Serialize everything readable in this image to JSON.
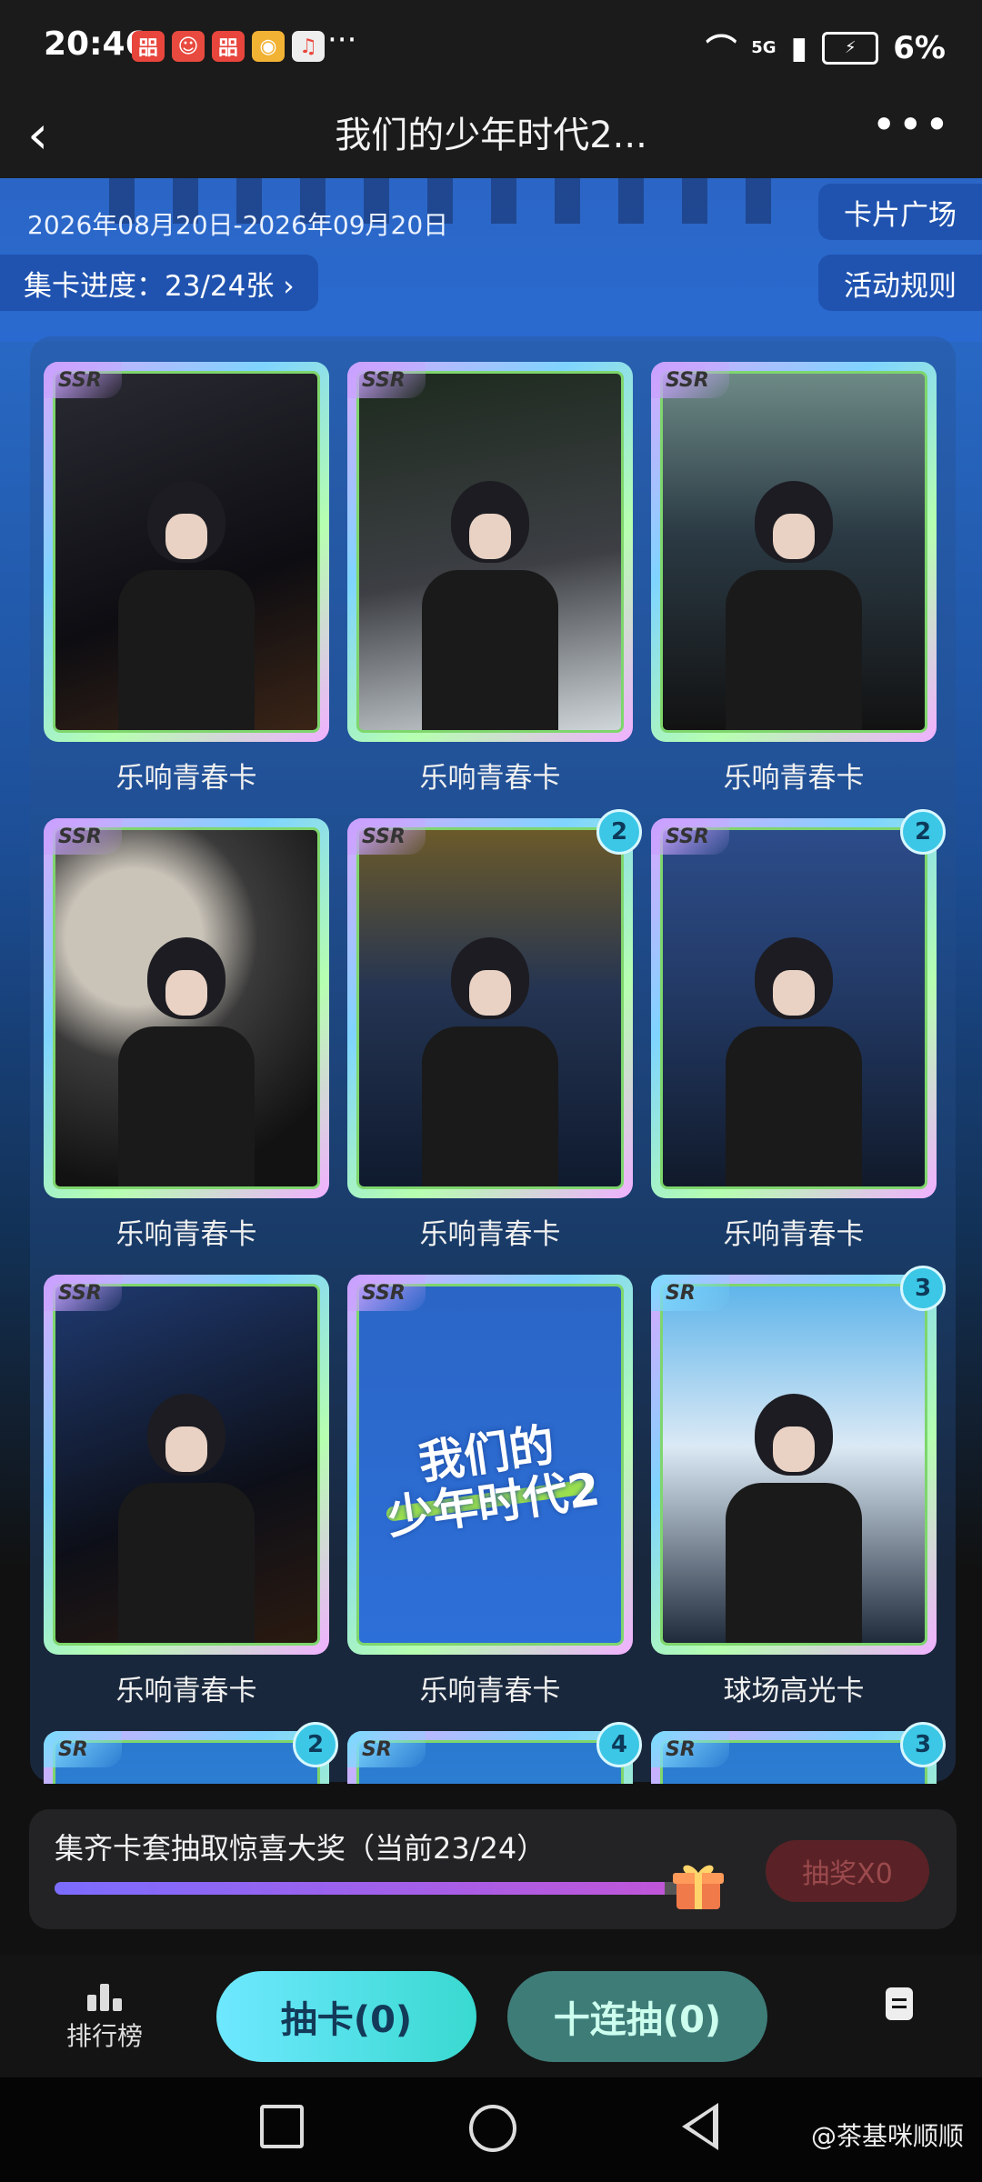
{
  "status_bar": {
    "time": "20:46",
    "more": "···",
    "network": "5G",
    "battery": "6%"
  },
  "header": {
    "title": "我们的少年时代2..."
  },
  "banner": {
    "date_range": "2026年08月20日-2026年09月20日",
    "progress_label": "集卡进度：23/24张 ›",
    "card_square_button": "卡片广场",
    "rules_button": "活动规则"
  },
  "cards": [
    {
      "rarity": "SSR",
      "name": "乐响青春卡",
      "count": "",
      "art": "violin"
    },
    {
      "rarity": "SSR",
      "name": "乐响青春卡",
      "count": "",
      "art": "drums"
    },
    {
      "rarity": "SSR",
      "name": "乐响青春卡",
      "count": "",
      "art": "keyboard"
    },
    {
      "rarity": "SSR",
      "name": "乐响青春卡",
      "count": "",
      "art": "guitar-dark"
    },
    {
      "rarity": "SSR",
      "name": "乐响青春卡",
      "count": "2",
      "art": "bass"
    },
    {
      "rarity": "SSR",
      "name": "乐响青春卡",
      "count": "2",
      "art": "electric-guitar"
    },
    {
      "rarity": "SSR",
      "name": "乐响青春卡",
      "count": "",
      "art": "guitar-portrait"
    },
    {
      "rarity": "SSR",
      "name": "乐响青春卡",
      "count": "",
      "art": "logo"
    },
    {
      "rarity": "SR",
      "name": "球场高光卡",
      "count": "3",
      "art": "laptop"
    },
    {
      "rarity": "SR",
      "name": "",
      "count": "2",
      "art": "partial"
    },
    {
      "rarity": "SR",
      "name": "",
      "count": "4",
      "art": "partial"
    },
    {
      "rarity": "SR",
      "name": "",
      "count": "3",
      "art": "partial"
    }
  ],
  "logo_text": {
    "line1": "我们的",
    "line2": "少年时代2"
  },
  "bottom_panel": {
    "text": "集齐卡套抽取惊喜大奖（当前23/24）",
    "progress": 0.958,
    "draw_button": "抽奖X0"
  },
  "tabbar": {
    "rank_label": "排行榜",
    "draw_one": "抽卡(0)",
    "draw_ten": "十连抽(0)"
  },
  "watermark": "@茶基咪顺顺",
  "colors": {
    "accent_cyan": "#3cc7e6",
    "ssr_tag": "#c9a2ff",
    "sr_tag": "#7fd9ff",
    "banner_blue": "#2b66c6"
  }
}
